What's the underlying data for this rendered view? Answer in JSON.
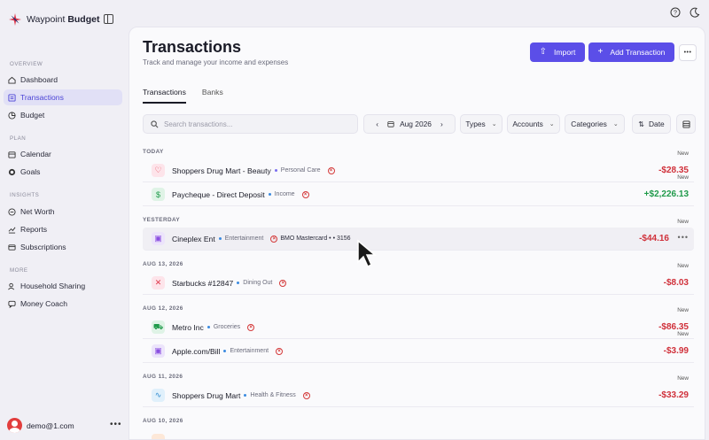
{
  "app": {
    "name_a": "Waypoint",
    "name_b": "Budget"
  },
  "sidebar": {
    "sections": [
      "OVERVIEW",
      "PLAN",
      "INSIGHTS",
      "MORE"
    ],
    "items": [
      {
        "label": "Dashboard"
      },
      {
        "label": "Transactions"
      },
      {
        "label": "Budget"
      },
      {
        "label": "Calendar"
      },
      {
        "label": "Goals"
      },
      {
        "label": "Net Worth"
      },
      {
        "label": "Reports"
      },
      {
        "label": "Subscriptions"
      },
      {
        "label": "Household Sharing"
      },
      {
        "label": "Money Coach"
      }
    ],
    "user_email": "demo@1.com"
  },
  "header": {
    "title": "Transactions",
    "subtitle": "Track and manage your income and expenses",
    "import_label": "Import",
    "add_label": "Add Transaction"
  },
  "tabs": [
    {
      "label": "Transactions"
    },
    {
      "label": "Banks"
    }
  ],
  "filters": {
    "search_placeholder": "Search transactions...",
    "month": "Aug 2026",
    "types": "Types",
    "accounts": "Accounts",
    "categories": "Categories",
    "sort": "Date"
  },
  "groups": [
    {
      "label": "TODAY"
    },
    {
      "label": "YESTERDAY"
    },
    {
      "label": "AUG 13, 2026"
    },
    {
      "label": "AUG 12, 2026"
    },
    {
      "label": "AUG 11, 2026"
    },
    {
      "label": "AUG 10, 2026"
    }
  ],
  "transactions": [
    {
      "merchant": "Shoppers Drug Mart - Beauty",
      "category": "Personal Care",
      "amount": "-$28.35",
      "tag": "New",
      "icon": "heart-icon"
    },
    {
      "merchant": "Paycheque - Direct Deposit",
      "category": "Income",
      "amount": "+$2,226.13",
      "tag": "New",
      "icon": "dollar-icon"
    },
    {
      "merchant": "Cineplex Ent",
      "category": "Entertainment",
      "account": "BMO Mastercard • • 3156",
      "amount": "-$44.16",
      "tag": "New",
      "icon": "film-icon"
    },
    {
      "merchant": "Starbucks #12847",
      "category": "Dining Out",
      "amount": "-$8.03",
      "tag": "New",
      "icon": "utensils-icon"
    },
    {
      "merchant": "Metro Inc",
      "category": "Groceries",
      "amount": "-$86.35",
      "tag": "New",
      "icon": "cart-icon"
    },
    {
      "merchant": "Apple.com/Bill",
      "category": "Entertainment",
      "amount": "-$3.99",
      "tag": "New",
      "icon": "film-icon"
    },
    {
      "merchant": "Shoppers Drug Mart",
      "category": "Health & Fitness",
      "amount": "-$33.29",
      "tag": "New",
      "icon": "pulse-icon"
    }
  ],
  "colors": {
    "accent": "#5b4ee8",
    "negative": "#d0303a",
    "positive": "#1f9a4a"
  }
}
